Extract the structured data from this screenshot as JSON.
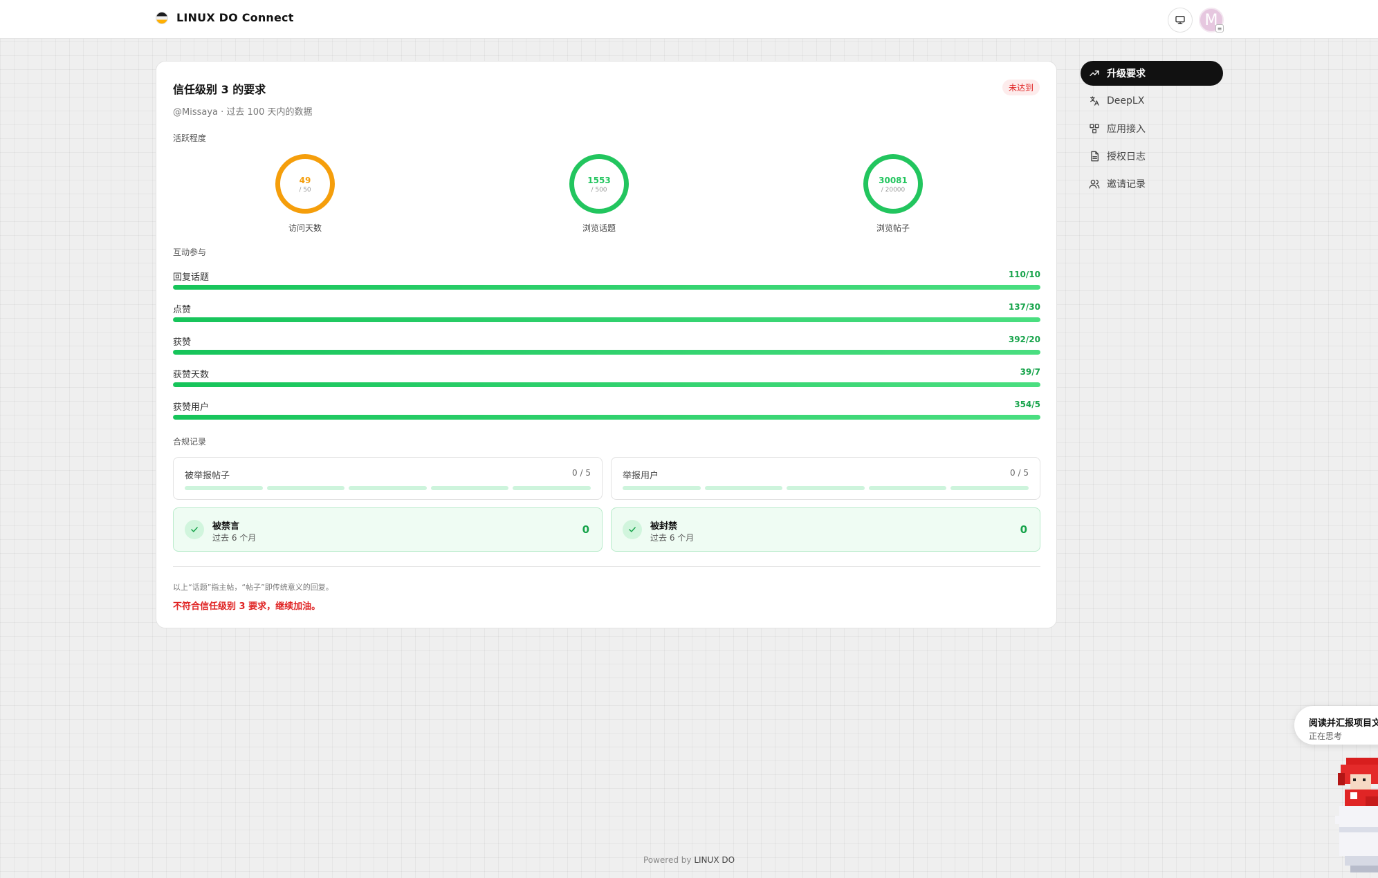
{
  "header": {
    "brand": "LINUX DO Connect"
  },
  "card": {
    "title": "信任级别 3 的要求",
    "status": "未达到",
    "subtitle": "@Missaya · 过去 100 天内的数据",
    "activity": {
      "label": "活跃程度",
      "rings": [
        {
          "value": "49",
          "target": "/ 50",
          "label": "访问天数",
          "color": "#f59e0b",
          "progress": 0.98
        },
        {
          "value": "1553",
          "target": "/ 500",
          "label": "浏览话题",
          "color": "#22c55e",
          "progress": 1.0
        },
        {
          "value": "30081",
          "target": "/ 20000",
          "label": "浏览帖子",
          "color": "#22c55e",
          "progress": 1.0
        }
      ]
    },
    "interaction": {
      "label": "互动参与",
      "items": [
        {
          "name": "回复话题",
          "value": "110/10",
          "progress": 1.0
        },
        {
          "name": "点赞",
          "value": "137/30",
          "progress": 1.0
        },
        {
          "name": "获赞",
          "value": "392/20",
          "progress": 1.0
        },
        {
          "name": "获赞天数",
          "value": "39/7",
          "progress": 1.0
        },
        {
          "name": "获赞用户",
          "value": "354/5",
          "progress": 1.0
        }
      ]
    },
    "compliance": {
      "label": "合规记录",
      "reports": [
        {
          "name": "被举报帖子",
          "value": "0 / 5"
        },
        {
          "name": "举报用户",
          "value": "0 / 5"
        }
      ],
      "penalties": [
        {
          "name": "被禁言",
          "period": "过去 6 个月",
          "count": "0"
        },
        {
          "name": "被封禁",
          "period": "过去 6 个月",
          "count": "0"
        }
      ]
    },
    "footnote": "以上“话题”指主帖，“帖子”即传统意义的回复。",
    "result": "不符合信任级别 3 要求，继续加油。"
  },
  "sidebar": {
    "items": [
      {
        "label": "升级要求",
        "icon": "trending-up-icon",
        "active": true
      },
      {
        "label": "DeepLX",
        "icon": "translate-icon",
        "active": false
      },
      {
        "label": "应用接入",
        "icon": "apps-icon",
        "active": false
      },
      {
        "label": "授权日志",
        "icon": "document-icon",
        "active": false
      },
      {
        "label": "邀请记录",
        "icon": "users-icon",
        "active": false
      }
    ]
  },
  "footer": {
    "prefix": "Powered by",
    "brand": "LINUX DO"
  },
  "assistant_popup": {
    "title": "阅读并汇报项目文",
    "status": "正在思考"
  },
  "avatar": {
    "letter": "M"
  },
  "colors": {
    "accent_green": "#22c55e",
    "warn_orange": "#f59e0b",
    "danger_red": "#e02424"
  }
}
